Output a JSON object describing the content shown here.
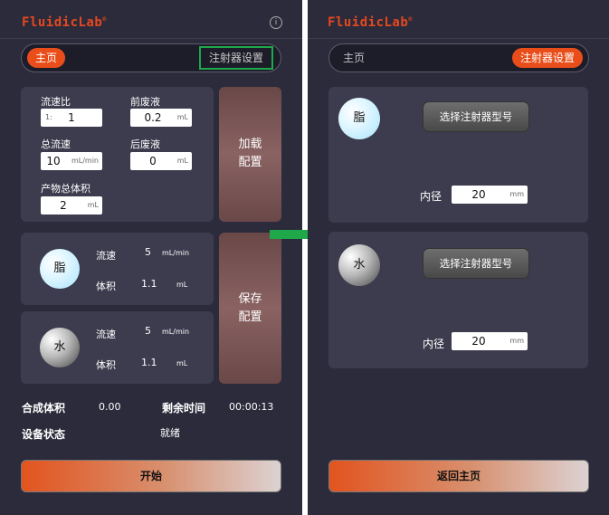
{
  "brand": {
    "logo": "FluidicLab",
    "reg": "®",
    "accent": "#e94e1a",
    "highlight": "#1ea84a"
  },
  "main": {
    "tabs": {
      "home": "主页",
      "syringe": "注射器设置"
    },
    "config": {
      "flow_ratio": {
        "label": "流速比",
        "prefix": "1:",
        "value": "1"
      },
      "pre_waste": {
        "label": "前废液",
        "value": "0.2",
        "unit": "mL"
      },
      "total_flow": {
        "label": "总流速",
        "value": "10",
        "unit": "mL/min"
      },
      "post_waste": {
        "label": "后废液",
        "value": "0",
        "unit": "mL"
      },
      "product_volume": {
        "label": "产物总体积",
        "value": "2",
        "unit": "mL"
      }
    },
    "load_button": [
      "加载",
      "配置"
    ],
    "save_button": [
      "保存",
      "配置"
    ],
    "channels": [
      {
        "name": "脂",
        "flow_label": "流速",
        "flow_value": "5",
        "flow_unit": "mL/min",
        "vol_label": "体积",
        "vol_value": "1.1",
        "vol_unit": "mL"
      },
      {
        "name": "水",
        "flow_label": "流速",
        "flow_value": "5",
        "flow_unit": "mL/min",
        "vol_label": "体积",
        "vol_value": "1.1",
        "vol_unit": "mL"
      }
    ],
    "status": {
      "synth_volume_label": "合成体积",
      "synth_volume_value": "0.00",
      "remaining_label": "剩余时间",
      "remaining_value": "00:00:13",
      "device_label": "设备状态",
      "device_value": "就绪"
    },
    "start_button": "开始"
  },
  "syringe": {
    "tabs": {
      "home": "主页",
      "syringe": "注射器设置"
    },
    "cards": [
      {
        "name": "脂",
        "select_label": "选择注射器型号",
        "diameter_label": "内径",
        "diameter_value": "20",
        "diameter_unit": "mm"
      },
      {
        "name": "水",
        "select_label": "选择注射器型号",
        "diameter_label": "内径",
        "diameter_value": "20",
        "diameter_unit": "mm"
      }
    ],
    "back_button": "返回主页"
  }
}
